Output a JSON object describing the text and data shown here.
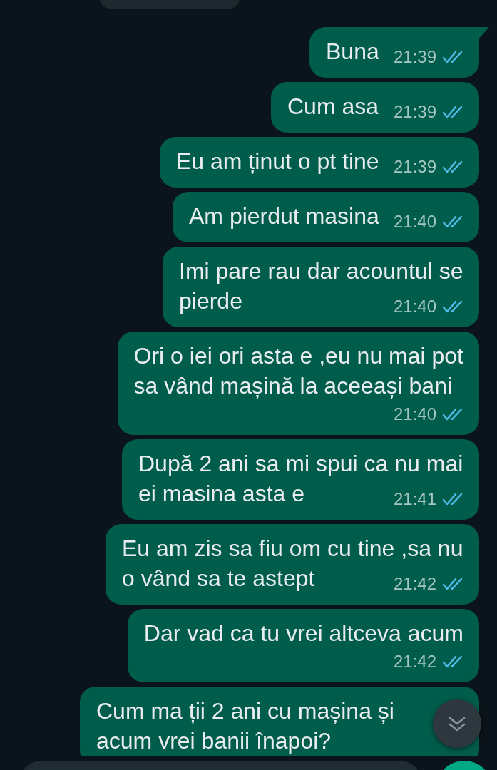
{
  "messages": [
    {
      "text": "Buna",
      "time": "21:39",
      "read": true,
      "tail": true
    },
    {
      "text": "Cum asa",
      "time": "21:39",
      "read": true,
      "tail": false
    },
    {
      "text": "Eu am ținut o pt tine",
      "time": "21:39",
      "read": true,
      "tail": false
    },
    {
      "text": "Am pierdut masina",
      "time": "21:40",
      "read": true,
      "tail": false
    },
    {
      "text": "Imi pare rau dar acountul se\npierde",
      "time": "21:40",
      "read": true,
      "tail": false
    },
    {
      "text": "Ori o iei ori asta e ,eu nu mai pot\nsa vând mașină la aceeași bani",
      "time": "21:40",
      "read": true,
      "tail": false
    },
    {
      "text": "După 2 ani sa mi spui ca nu mai\nei masina asta e",
      "time": "21:41",
      "read": true,
      "tail": false
    },
    {
      "text": "Eu am zis sa fiu om cu tine ,sa nu\no vând sa te astept",
      "time": "21:42",
      "read": true,
      "tail": false
    },
    {
      "text": "Dar vad ca tu vrei altceva acum",
      "time": "21:42",
      "read": true,
      "tail": false
    },
    {
      "text": "Cum ma ții 2 ani cu mașina și\nacum vrei banii înapoi?",
      "tail": false
    }
  ]
}
